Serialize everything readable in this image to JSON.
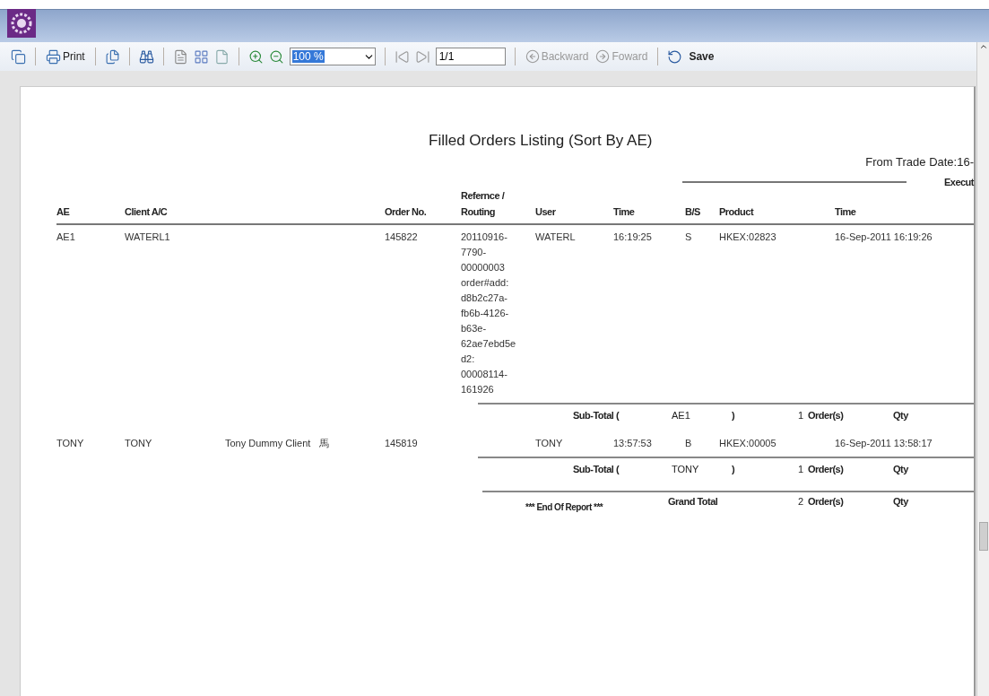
{
  "toolbar": {
    "print": "Print",
    "zoom": {
      "value": "100 %",
      "selected": true
    },
    "page": "1/1",
    "backward": {
      "label": "Backward",
      "disabled": true
    },
    "forward": {
      "label": "Foward",
      "disabled": true
    },
    "save": "Save"
  },
  "report": {
    "title": "Filled Orders Listing (Sort By AE)",
    "date_range": "From Trade Date:16-",
    "group_header": "Execut",
    "columns": [
      "AE",
      "Client A/C",
      "Order No.",
      "Refernce /\nRouting",
      "User",
      "Time",
      "B/S",
      "Product",
      "Time"
    ],
    "groups": [
      {
        "rows": [
          {
            "ae": "AE1",
            "client_ac": "WATERL1",
            "order_no": "145822",
            "reference": "20110916-\n7790-\n00000003\norder#add:\nd8b2c27a-\nfb6b-4126-\nb63e-\n62ae7ebd5e\nd2:\n00008114-\n161926",
            "user": "WATERL",
            "time": "16:19:25",
            "side": "S",
            "product": "HKEX:02823",
            "exec_time": "16-Sep-2011 16:19:26"
          }
        ],
        "subtotal": {
          "label": "Sub-Total (",
          "key": "AE1",
          "close": ")",
          "count": "1",
          "orders": "Order(s)",
          "qty": "Qty"
        }
      },
      {
        "rows": [
          {
            "ae": "TONY",
            "client_ac": "TONY",
            "client_name": "Tony Dummy Client",
            "client_name_cn": "馬",
            "order_no": "145819",
            "user": "TONY",
            "time": "13:57:53",
            "side": "B",
            "product": "HKEX:00005",
            "exec_time": "16-Sep-2011 13:58:17"
          }
        ],
        "subtotal": {
          "label": "Sub-Total (",
          "key": "TONY",
          "close": ")",
          "count": "1",
          "orders": "Order(s)",
          "qty": "Qty"
        }
      }
    ],
    "grand_total": {
      "label": "Grand Total",
      "count": "2",
      "orders": "Order(s)",
      "qty": "Qty"
    },
    "end_text": "*** End Of Report ***"
  }
}
